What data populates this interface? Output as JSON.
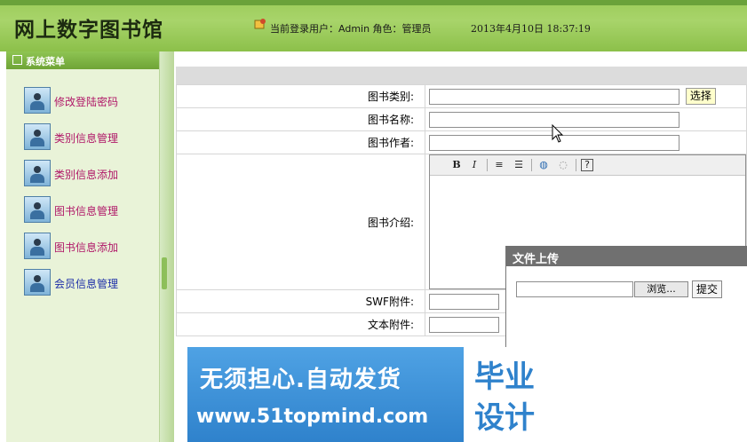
{
  "header": {
    "title": "网上数字图书馆",
    "user_info": "当前登录用户：Admin 角色：管理员",
    "datetime": "2013年4月10日   18:37:19"
  },
  "sidebar": {
    "menu_title": "系统菜单",
    "items": [
      {
        "label": "修改登陆密码",
        "icon": "user-icon"
      },
      {
        "label": "类别信息管理",
        "icon": "user-icon"
      },
      {
        "label": "类别信息添加",
        "icon": "user-icon"
      },
      {
        "label": "图书信息管理",
        "icon": "user-icon"
      },
      {
        "label": "图书信息添加",
        "icon": "user-icon"
      },
      {
        "label": "会员信息管理",
        "icon": "user-icon"
      }
    ]
  },
  "form": {
    "category_label": "图书类别:",
    "category_value": "",
    "select_button": "选择",
    "name_label": "图书名称:",
    "name_value": "",
    "author_label": "图书作者:",
    "author_value": "",
    "intro_label": "图书介绍:",
    "swf_label": "SWF附件:",
    "text_label": "文本附件:",
    "editor_toolbar": [
      {
        "label": "B",
        "icon": "bold-icon"
      },
      {
        "label": "I",
        "icon": "italic-icon"
      },
      {
        "label": "≡",
        "icon": "ordered-list-icon"
      },
      {
        "label": "☰",
        "icon": "unordered-list-icon"
      },
      {
        "label": "◍",
        "icon": "link-icon"
      },
      {
        "label": "◌",
        "icon": "unlink-icon"
      },
      {
        "label": "?",
        "icon": "help-icon"
      }
    ]
  },
  "upload_dialog": {
    "title": "文件上传",
    "browse_button": "浏览...",
    "submit_button": "提交"
  },
  "banner": {
    "line1": "无须担心.自动发货",
    "line2": "www.51topmind.com",
    "badge_line1": "毕业",
    "badge_line2": "设计"
  }
}
